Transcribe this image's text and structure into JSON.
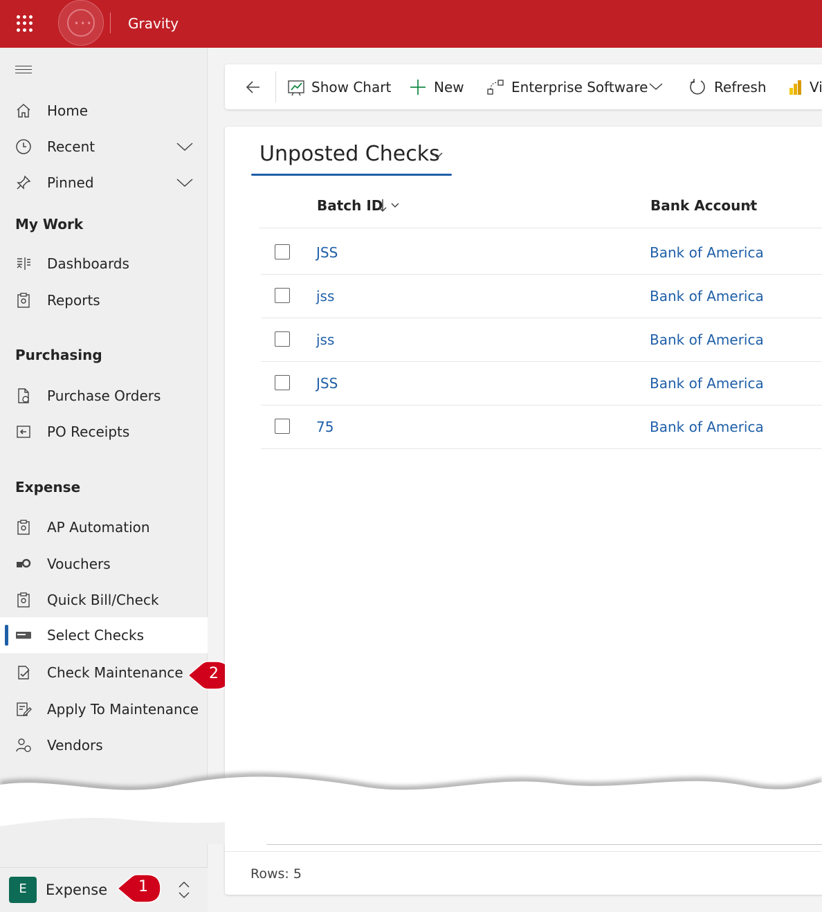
{
  "header": {
    "app_name": "Gravity"
  },
  "sidebar": {
    "top_items": [
      {
        "label": "Home"
      },
      {
        "label": "Recent"
      },
      {
        "label": "Pinned"
      }
    ],
    "groups": [
      {
        "title": "My Work",
        "items": [
          {
            "label": "Dashboards"
          },
          {
            "label": "Reports"
          }
        ]
      },
      {
        "title": "Purchasing",
        "items": [
          {
            "label": "Purchase Orders"
          },
          {
            "label": "PO Receipts"
          }
        ]
      },
      {
        "title": "Expense",
        "items": [
          {
            "label": "AP Automation"
          },
          {
            "label": "Vouchers"
          },
          {
            "label": "Quick Bill/Check"
          },
          {
            "label": "Select Checks",
            "selected": true
          },
          {
            "label": "Check Maintenance"
          },
          {
            "label": "Apply To Maintenance"
          },
          {
            "label": "Vendors"
          }
        ]
      }
    ],
    "area": {
      "badge": "E",
      "label": "Expense"
    }
  },
  "callouts": {
    "first": "1",
    "second": "2"
  },
  "toolbar": {
    "show_chart": "Show Chart",
    "new": "New",
    "enterprise": "Enterprise Software",
    "refresh": "Refresh",
    "truncated": "Vi"
  },
  "view": {
    "title": "Unposted Checks",
    "columns": {
      "batch_id": "Batch ID",
      "bank_account": "Bank Account"
    },
    "rows": [
      {
        "batch_id": "JSS",
        "bank_account": "Bank of America"
      },
      {
        "batch_id": "jss",
        "bank_account": "Bank of America"
      },
      {
        "batch_id": "jss",
        "bank_account": "Bank of America"
      },
      {
        "batch_id": "JSS",
        "bank_account": "Bank of America"
      },
      {
        "batch_id": "75",
        "bank_account": "Bank of America"
      }
    ],
    "rows_count": "Rows: 5"
  },
  "colors": {
    "brand": "#c01f26",
    "accent": "#1f5fa8",
    "area_badge": "#0e6b55",
    "callout": "#d0021b"
  }
}
